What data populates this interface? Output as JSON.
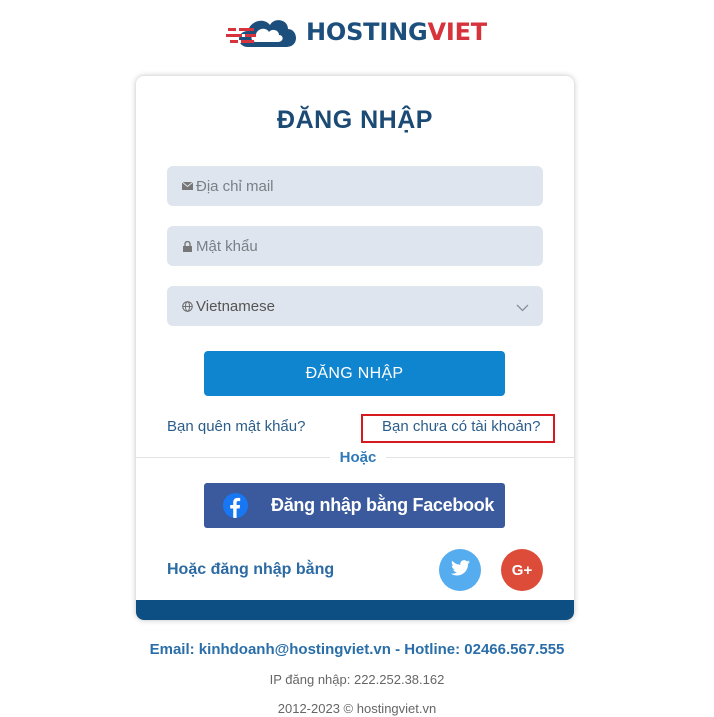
{
  "brand": {
    "name_part1": "HOSTING",
    "name_part2": "VIET"
  },
  "login": {
    "title": "ĐĂNG NHẬP",
    "email_placeholder": "Địa chỉ mail",
    "password_placeholder": "Mật khẩu",
    "language_selected": "Vietnamese",
    "submit_label": "ĐĂNG NHẬP",
    "forgot_link": "Bạn quên mật khẩu?",
    "register_link": "Bạn chưa có tài khoản?",
    "or_text": "Hoặc",
    "facebook_label": "Đăng nhập bằng Facebook",
    "social_label": "Hoặc đăng nhập bằng",
    "google_text": "G+"
  },
  "footer": {
    "email_text": "Email: kinhdoanh@hostingviet.vn",
    "separator": " - ",
    "hotline_text": "Hotline: 02466.567.555",
    "ip_text": "IP đăng nhập: 222.252.38.162",
    "copyright": "2012-2023 © hostingviet.vn"
  },
  "colors": {
    "primary_button": "#0f85d0",
    "facebook": "#3b5a9d",
    "twitter": "#55acee",
    "google": "#dd4b39",
    "card_footer": "#0d4f82",
    "highlight_box": "#d71920"
  },
  "icons": [
    "mail-icon",
    "lock-icon",
    "globe-icon",
    "chevron-down-icon",
    "facebook-icon",
    "twitter-icon",
    "google-plus-icon"
  ]
}
